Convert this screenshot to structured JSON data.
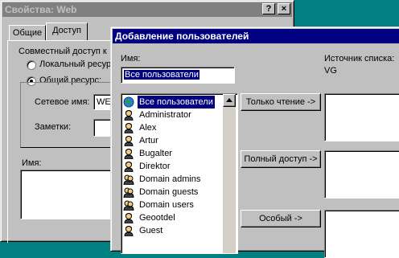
{
  "props": {
    "title": "Свойства: Web",
    "help_btn": "?",
    "close_btn": "×",
    "tabs": [
      "Общие",
      "Доступ"
    ],
    "share_group_label": "Совместный доступ к",
    "radio_local": "Локальный ресурс",
    "radio_shared": "Общий ресурс:",
    "net_name_label": "Сетевое имя:",
    "net_name_value": "WEB",
    "notes_label": "Заметки:",
    "name_label": "Имя:"
  },
  "dialog": {
    "title": "Добавление пользователей",
    "name_label": "Имя:",
    "name_value": "Все пользователи",
    "source_label": "Источник списка:",
    "source_value": "VG",
    "buttons": {
      "read_only": "Только чтение ->",
      "full_access": "Полный доступ ->",
      "custom": "Особый ->"
    },
    "users": [
      {
        "name": "Все пользователи",
        "icon": "globe-icon",
        "selected": true
      },
      {
        "name": "Administrator",
        "icon": "user-icon"
      },
      {
        "name": "Alex",
        "icon": "user-icon"
      },
      {
        "name": "Artur",
        "icon": "user-icon"
      },
      {
        "name": "Bugalter",
        "icon": "user-icon"
      },
      {
        "name": "Direktor",
        "icon": "user-icon"
      },
      {
        "name": "Domain admins",
        "icon": "group-icon"
      },
      {
        "name": "Domain guests",
        "icon": "group-icon"
      },
      {
        "name": "Domain users",
        "icon": "group-icon"
      },
      {
        "name": "Geootdel",
        "icon": "user-icon"
      },
      {
        "name": "Guest",
        "icon": "user-icon"
      }
    ]
  },
  "colors": {
    "active_title": "#000080",
    "inactive_title": "#808080",
    "desktop": "#008080"
  }
}
